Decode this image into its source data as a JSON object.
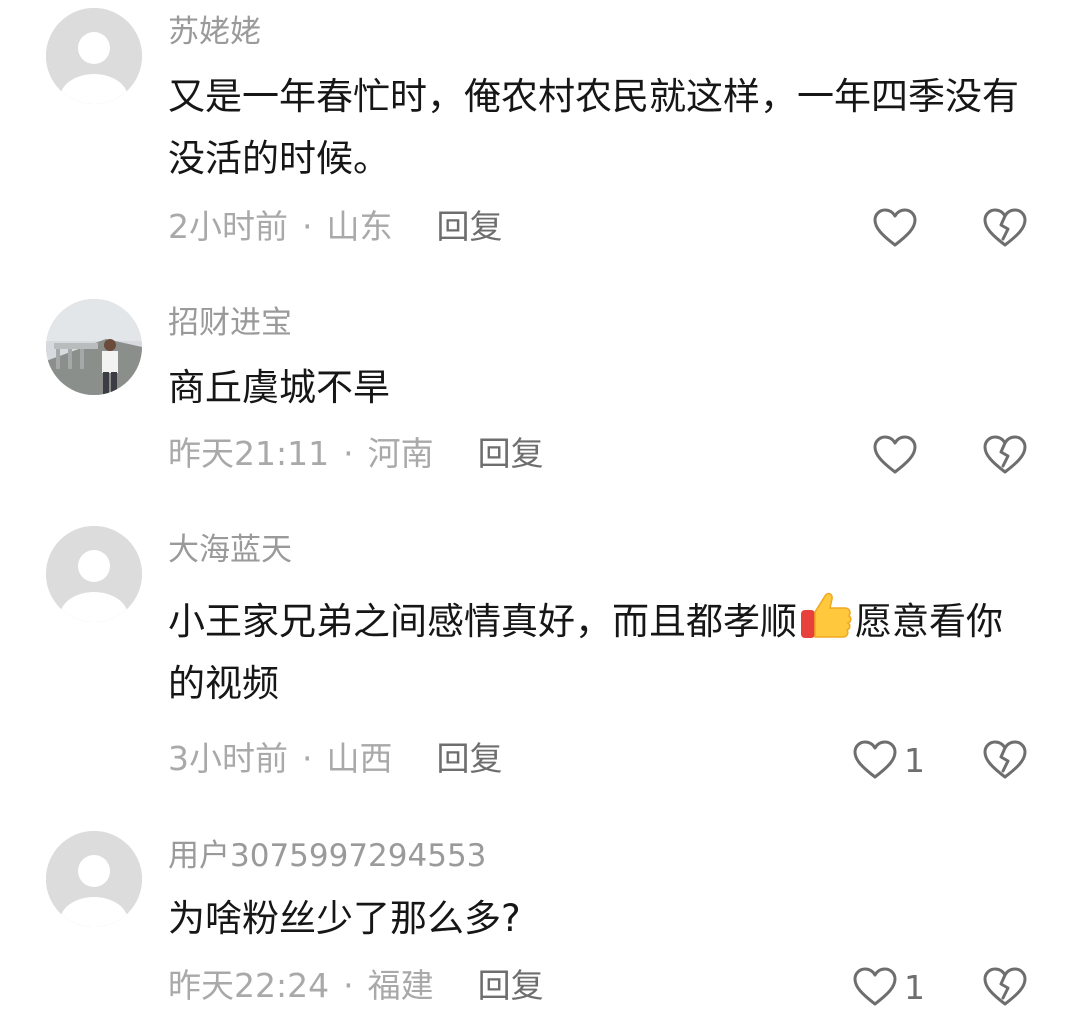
{
  "comments": [
    {
      "username": "苏姥姥",
      "text": "又是一年春忙时，俺农村农民就这样，一年四季没有没活的时候。",
      "time": "2小时前",
      "location": "山东",
      "reply_label": "回复",
      "like_count": ""
    },
    {
      "username": "招财进宝",
      "text": "商丘虞城不旱",
      "time": "昨天21:11",
      "location": "河南",
      "reply_label": "回复",
      "like_count": ""
    },
    {
      "username": "大海蓝天",
      "text_before": "小王家兄弟之间感情真好，而且都孝顺",
      "emoji": "thumbs-up-icon",
      "text_after": "愿意看你的视频",
      "time": "3小时前",
      "location": "山西",
      "reply_label": "回复",
      "like_count": "1"
    },
    {
      "username": "用户3075997294553",
      "text": "为啥粉丝少了那么多?",
      "time": "昨天22:24",
      "location": "福建",
      "reply_label": "回复",
      "like_count": "1"
    }
  ],
  "separator": "·",
  "colors": {
    "username": "#9a9a9a",
    "text": "#161616",
    "meta": "#a9a9a9",
    "action": "#6e6e6e"
  }
}
